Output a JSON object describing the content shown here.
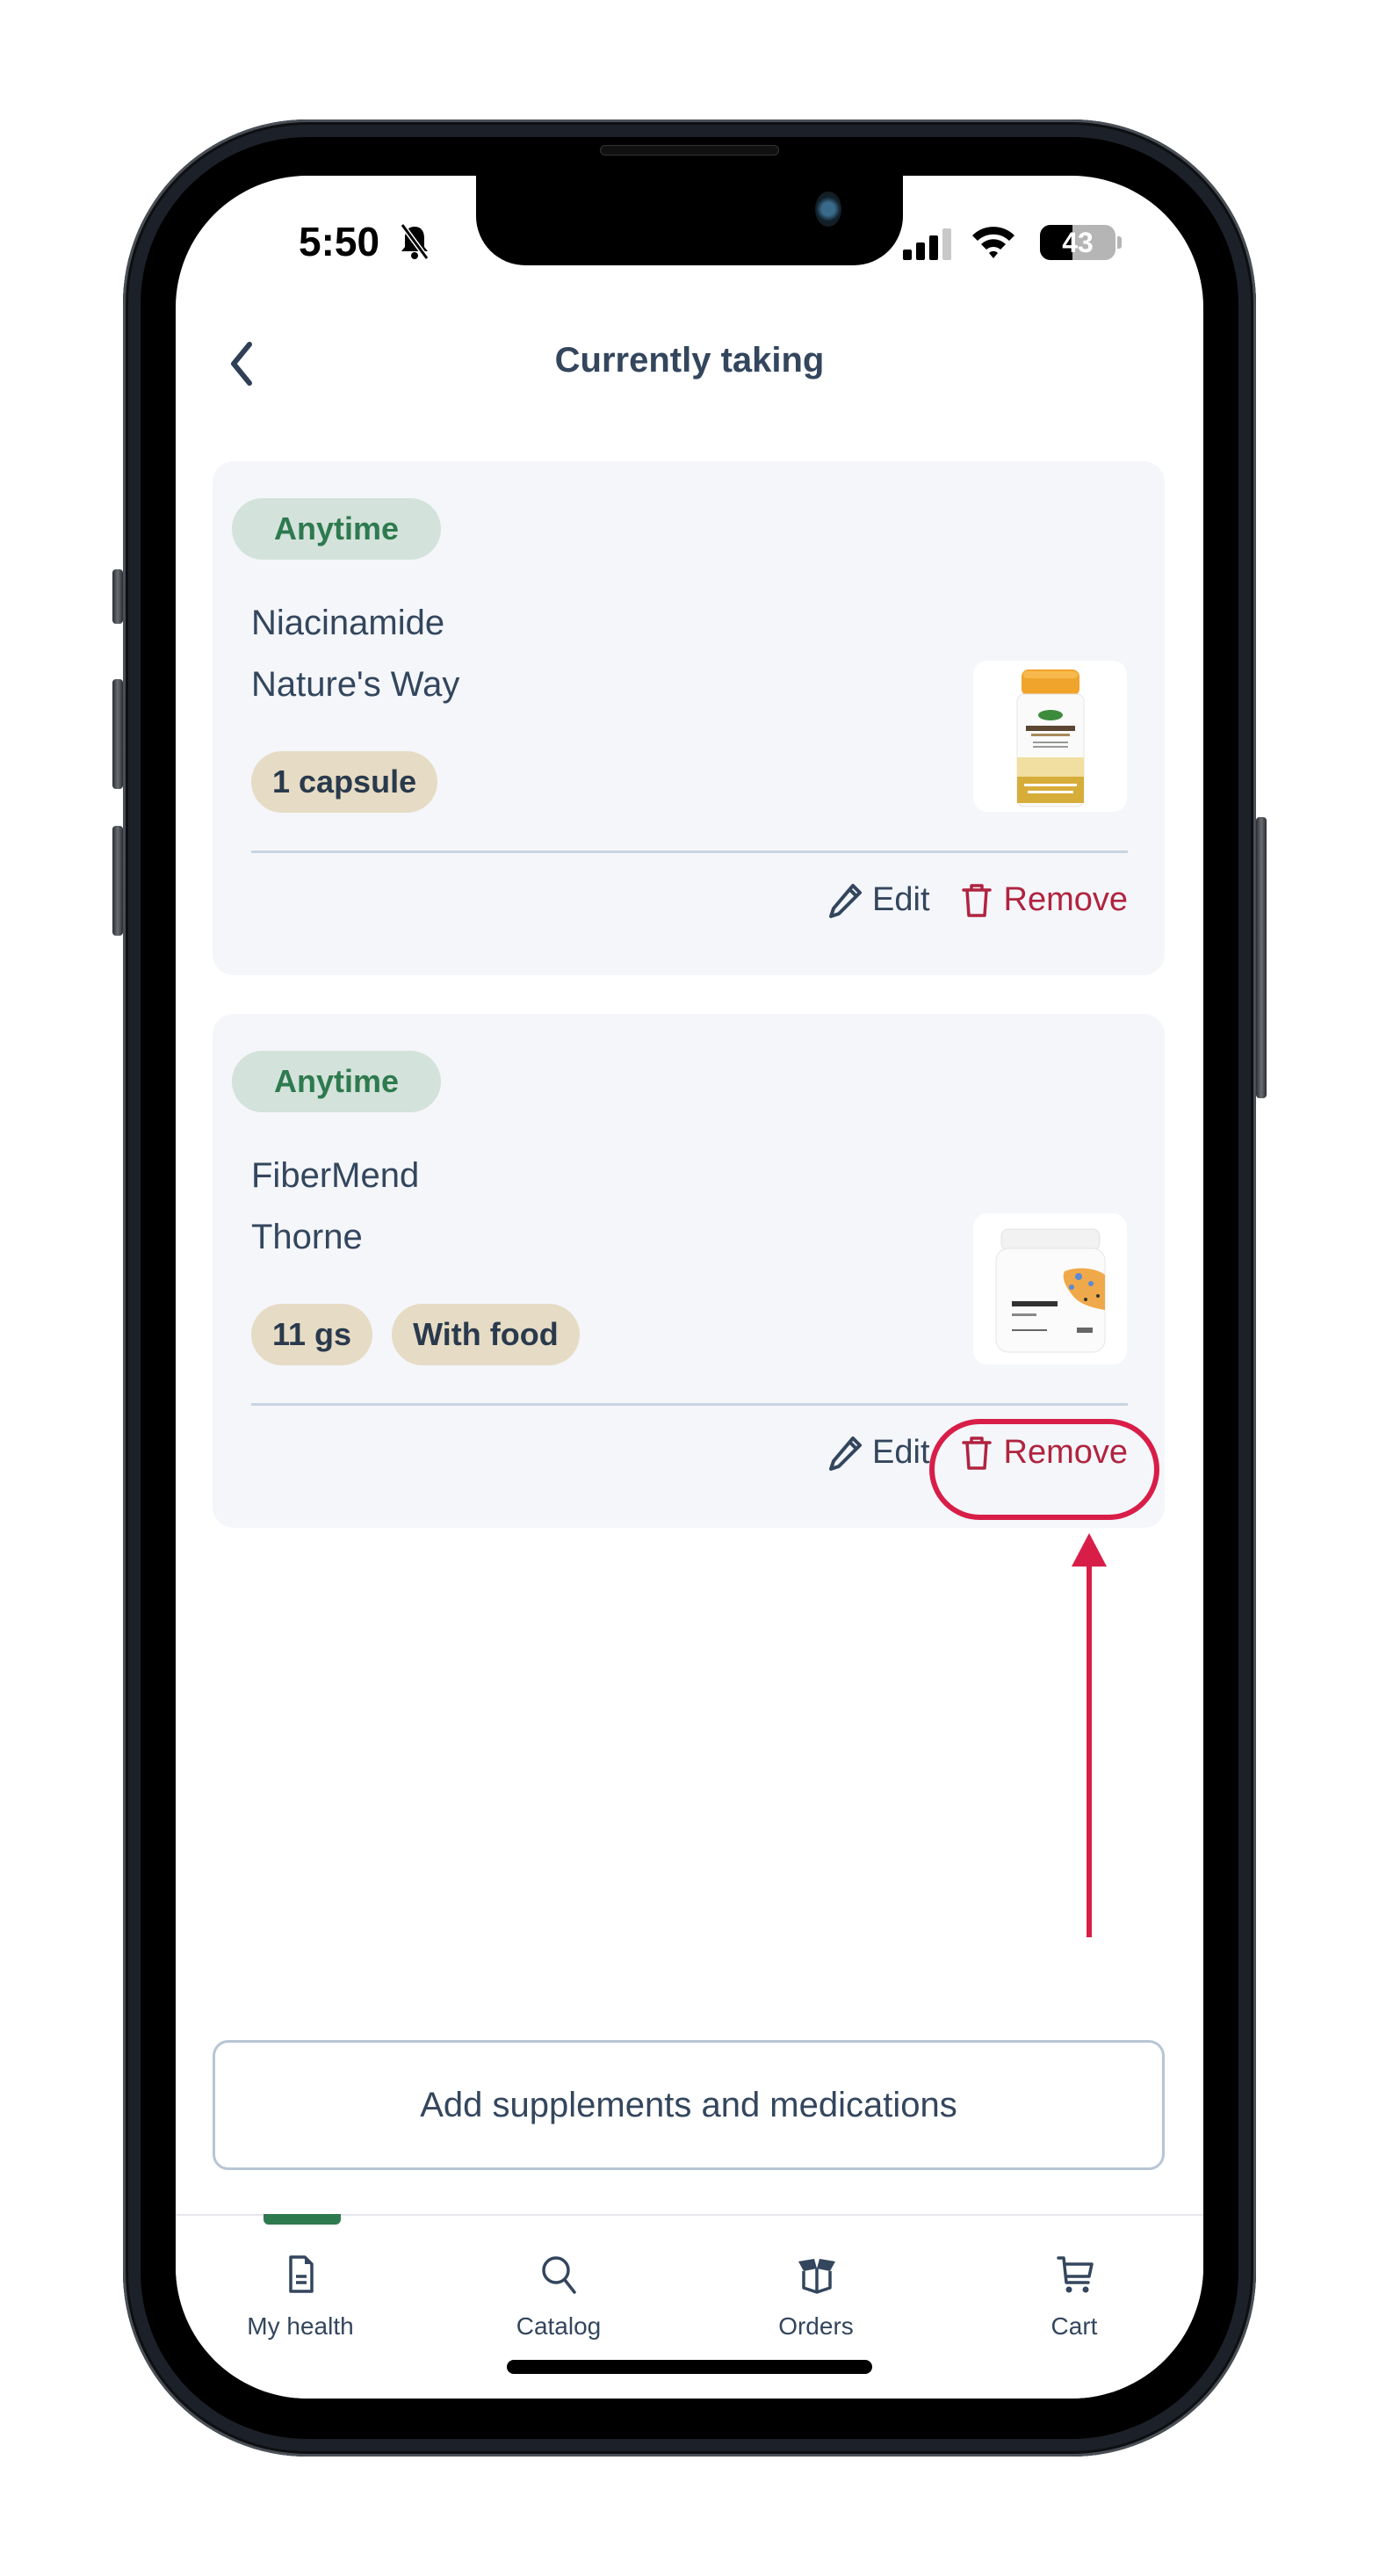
{
  "status_bar": {
    "time": "5:50",
    "silent_mode": true,
    "battery_percent": 43,
    "battery_label": "43"
  },
  "header": {
    "title": "Currently taking",
    "back_icon": "chevron-left-icon"
  },
  "supplements": [
    {
      "timing": "Anytime",
      "name": "Niacinamide",
      "brand": "Nature's Way",
      "dose_chips": [
        "1 capsule"
      ],
      "image": "Nature's Way Niacinamide bottle",
      "edit_label": "Edit",
      "remove_label": "Remove"
    },
    {
      "timing": "Anytime",
      "name": "FiberMend",
      "brand": "Thorne",
      "dose_chips": [
        "11 gs",
        "With food"
      ],
      "image": "Thorne FiberMend tub",
      "edit_label": "Edit",
      "remove_label": "Remove"
    }
  ],
  "annotation": {
    "target": "Remove",
    "color": "#d81e48"
  },
  "add_button": {
    "label": "Add supplements and medications"
  },
  "tab_bar": {
    "active": "My health",
    "tabs": [
      {
        "label": "My health",
        "icon": "document-icon"
      },
      {
        "label": "Catalog",
        "icon": "search-icon"
      },
      {
        "label": "Orders",
        "icon": "box-icon"
      },
      {
        "label": "Cart",
        "icon": "cart-icon"
      }
    ]
  },
  "colors": {
    "accent_green": "#2e7a4f",
    "remove_red": "#b0243f",
    "text_primary": "#33465d",
    "card_bg": "#f4f6fa",
    "timing_chip_bg": "#d3e2da",
    "dose_chip_bg": "#e6dbc4"
  }
}
